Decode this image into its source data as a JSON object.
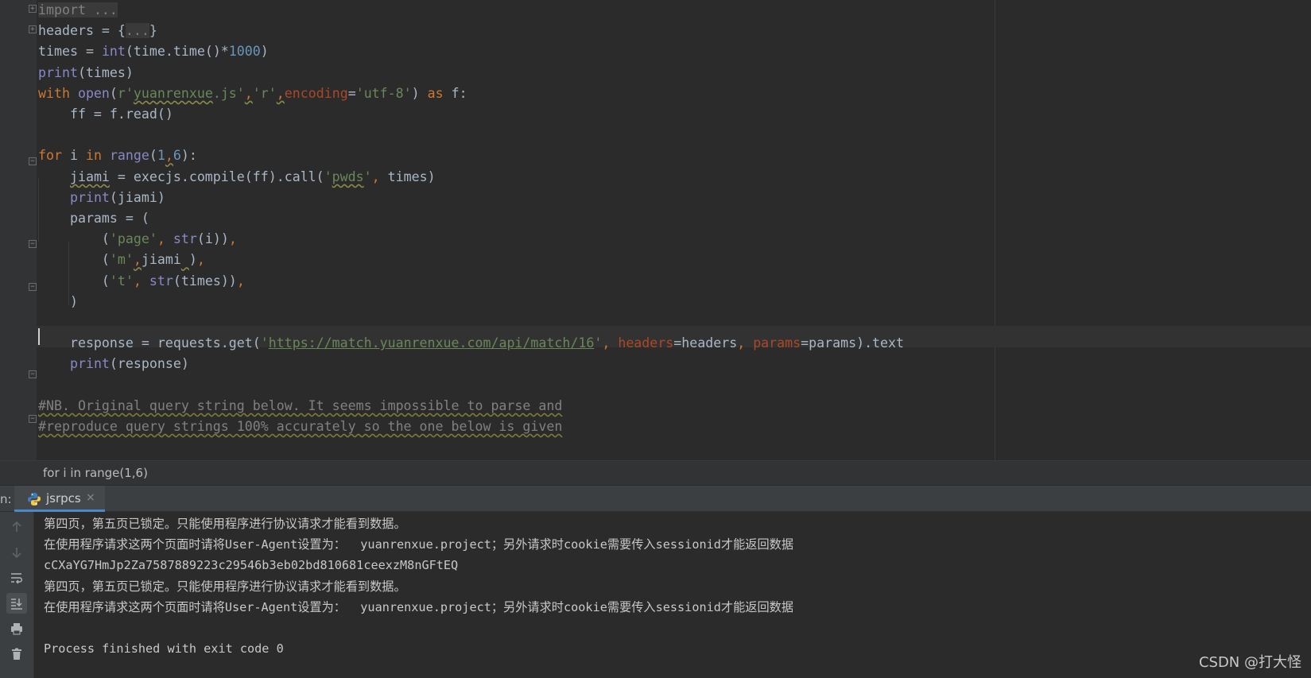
{
  "editor": {
    "lines": [
      {
        "segments": [
          {
            "t": "import ",
            "c": "fold-txt"
          },
          {
            "t": "...",
            "c": "fold-txt"
          }
        ]
      },
      {
        "segments": [
          {
            "t": "headers = {",
            "c": ""
          },
          {
            "t": "...",
            "c": "fold-txt"
          },
          {
            "t": "}",
            "c": ""
          }
        ]
      },
      {
        "segments": [
          {
            "t": "times = ",
            "c": ""
          },
          {
            "t": "int",
            "c": "bi"
          },
          {
            "t": "(time.time()*",
            "c": ""
          },
          {
            "t": "1000",
            "c": "num"
          },
          {
            "t": ")",
            "c": ""
          }
        ]
      },
      {
        "segments": [
          {
            "t": "print",
            "c": "bi"
          },
          {
            "t": "(times)",
            "c": ""
          }
        ]
      },
      {
        "segments": [
          {
            "t": "with ",
            "c": "kw"
          },
          {
            "t": "open",
            "c": "bi"
          },
          {
            "t": "(",
            "c": ""
          },
          {
            "t": "r'",
            "c": "str"
          },
          {
            "t": "yuanrenxue",
            "c": "str sq"
          },
          {
            "t": ".js'",
            "c": "str"
          },
          {
            "t": ",",
            "c": "kw sq"
          },
          {
            "t": "'r'",
            "c": "str"
          },
          {
            "t": ",",
            "c": "kw sq"
          },
          {
            "t": "encoding",
            "c": "kwarg"
          },
          {
            "t": "=",
            "c": ""
          },
          {
            "t": "'utf-8'",
            "c": "str"
          },
          {
            "t": ") ",
            "c": ""
          },
          {
            "t": "as ",
            "c": "kw"
          },
          {
            "t": "f:",
            "c": ""
          }
        ]
      },
      {
        "segments": [
          {
            "t": "    ff = f.read()",
            "c": ""
          }
        ]
      },
      {
        "segments": [
          {
            "t": "",
            "c": ""
          }
        ]
      },
      {
        "segments": [
          {
            "t": "for ",
            "c": "kw"
          },
          {
            "t": "i ",
            "c": ""
          },
          {
            "t": "in ",
            "c": "kw"
          },
          {
            "t": "range",
            "c": "bi"
          },
          {
            "t": "(",
            "c": ""
          },
          {
            "t": "1",
            "c": "num"
          },
          {
            "t": ",",
            "c": "kw sq"
          },
          {
            "t": "6",
            "c": "num"
          },
          {
            "t": "):",
            "c": ""
          }
        ]
      },
      {
        "segments": [
          {
            "t": "    ",
            "c": ""
          },
          {
            "t": "jiami",
            "c": "sq"
          },
          {
            "t": " = execjs.compile(ff).call(",
            "c": ""
          },
          {
            "t": "'",
            "c": "str"
          },
          {
            "t": "pwds",
            "c": "str sq"
          },
          {
            "t": "'",
            "c": "str"
          },
          {
            "t": ", ",
            "c": "kw"
          },
          {
            "t": "times)",
            "c": ""
          }
        ]
      },
      {
        "segments": [
          {
            "t": "    ",
            "c": ""
          },
          {
            "t": "print",
            "c": "bi"
          },
          {
            "t": "(jiami)",
            "c": ""
          }
        ]
      },
      {
        "segments": [
          {
            "t": "    params = (",
            "c": ""
          }
        ]
      },
      {
        "segments": [
          {
            "t": "        (",
            "c": ""
          },
          {
            "t": "'page'",
            "c": "str"
          },
          {
            "t": ", ",
            "c": "kw"
          },
          {
            "t": "str",
            "c": "bi"
          },
          {
            "t": "(i))",
            "c": ""
          },
          {
            "t": ",",
            "c": "kw"
          }
        ]
      },
      {
        "segments": [
          {
            "t": "        (",
            "c": ""
          },
          {
            "t": "'m'",
            "c": "str"
          },
          {
            "t": ",",
            "c": "kw sq"
          },
          {
            "t": "jiami",
            "c": ""
          },
          {
            "t": " ",
            "c": "sq"
          },
          {
            "t": ")",
            "c": ""
          },
          {
            "t": ",",
            "c": "kw"
          }
        ]
      },
      {
        "segments": [
          {
            "t": "        (",
            "c": ""
          },
          {
            "t": "'t'",
            "c": "str"
          },
          {
            "t": ", ",
            "c": "kw"
          },
          {
            "t": "str",
            "c": "bi"
          },
          {
            "t": "(times))",
            "c": ""
          },
          {
            "t": ",",
            "c": "kw"
          }
        ]
      },
      {
        "segments": [
          {
            "t": "    )",
            "c": ""
          }
        ]
      },
      {
        "segments": [
          {
            "t": "",
            "c": ""
          }
        ]
      },
      {
        "segments": [
          {
            "t": "    response = requests.get(",
            "c": ""
          },
          {
            "t": "'",
            "c": "str"
          },
          {
            "t": "https://match.yuanrenxue.com/api/match/16",
            "c": "str url"
          },
          {
            "t": "'",
            "c": "str"
          },
          {
            "t": ", ",
            "c": "kw"
          },
          {
            "t": "headers",
            "c": "kwarg"
          },
          {
            "t": "=headers",
            "c": ""
          },
          {
            "t": ", ",
            "c": "kw"
          },
          {
            "t": "params",
            "c": "kwarg"
          },
          {
            "t": "=params).text",
            "c": ""
          }
        ]
      },
      {
        "segments": [
          {
            "t": "    ",
            "c": ""
          },
          {
            "t": "print",
            "c": "bi"
          },
          {
            "t": "(response)",
            "c": ""
          }
        ]
      },
      {
        "segments": [
          {
            "t": "",
            "c": ""
          }
        ]
      },
      {
        "segments": [
          {
            "t": "#NB. Original query string below. It seems impossible to parse and",
            "c": "cmt"
          }
        ]
      },
      {
        "segments": [
          {
            "t": "#reproduce query strings 100% accurately so the one below is given",
            "c": "cmt"
          }
        ]
      }
    ]
  },
  "breadcrumb": {
    "text": "for i in range(1,6)"
  },
  "run_panel": {
    "label": "n:",
    "tab_label": "jsrpcs",
    "tab_close": "×"
  },
  "console": {
    "lines": [
      "第四页，第五页已锁定。只能使用程序进行协议请求才能看到数据。",
      "在使用程序请求这两个页面时请将User-Agent设置为：  yuanrenxue.project；另外请求时cookie需要传入sessionid才能返回数据",
      "cCXaYG7HmJp2Za7587889223c29546b3eb02bd810681ceexzM8nGFtEQ",
      "第四页，第五页已锁定。只能使用程序进行协议请求才能看到数据。",
      "在使用程序请求这两个页面时请将User-Agent设置为：  yuanrenxue.project；另外请求时cookie需要传入sessionid才能返回数据",
      "",
      "Process finished with exit code 0"
    ]
  },
  "watermark": "CSDN @打大怪",
  "icons": {
    "up": "arrow-up-icon",
    "down": "arrow-down-icon",
    "wrap": "soft-wrap-icon",
    "scroll": "scroll-to-end-icon",
    "print": "print-icon",
    "trash": "trash-icon",
    "python": "python-icon"
  }
}
